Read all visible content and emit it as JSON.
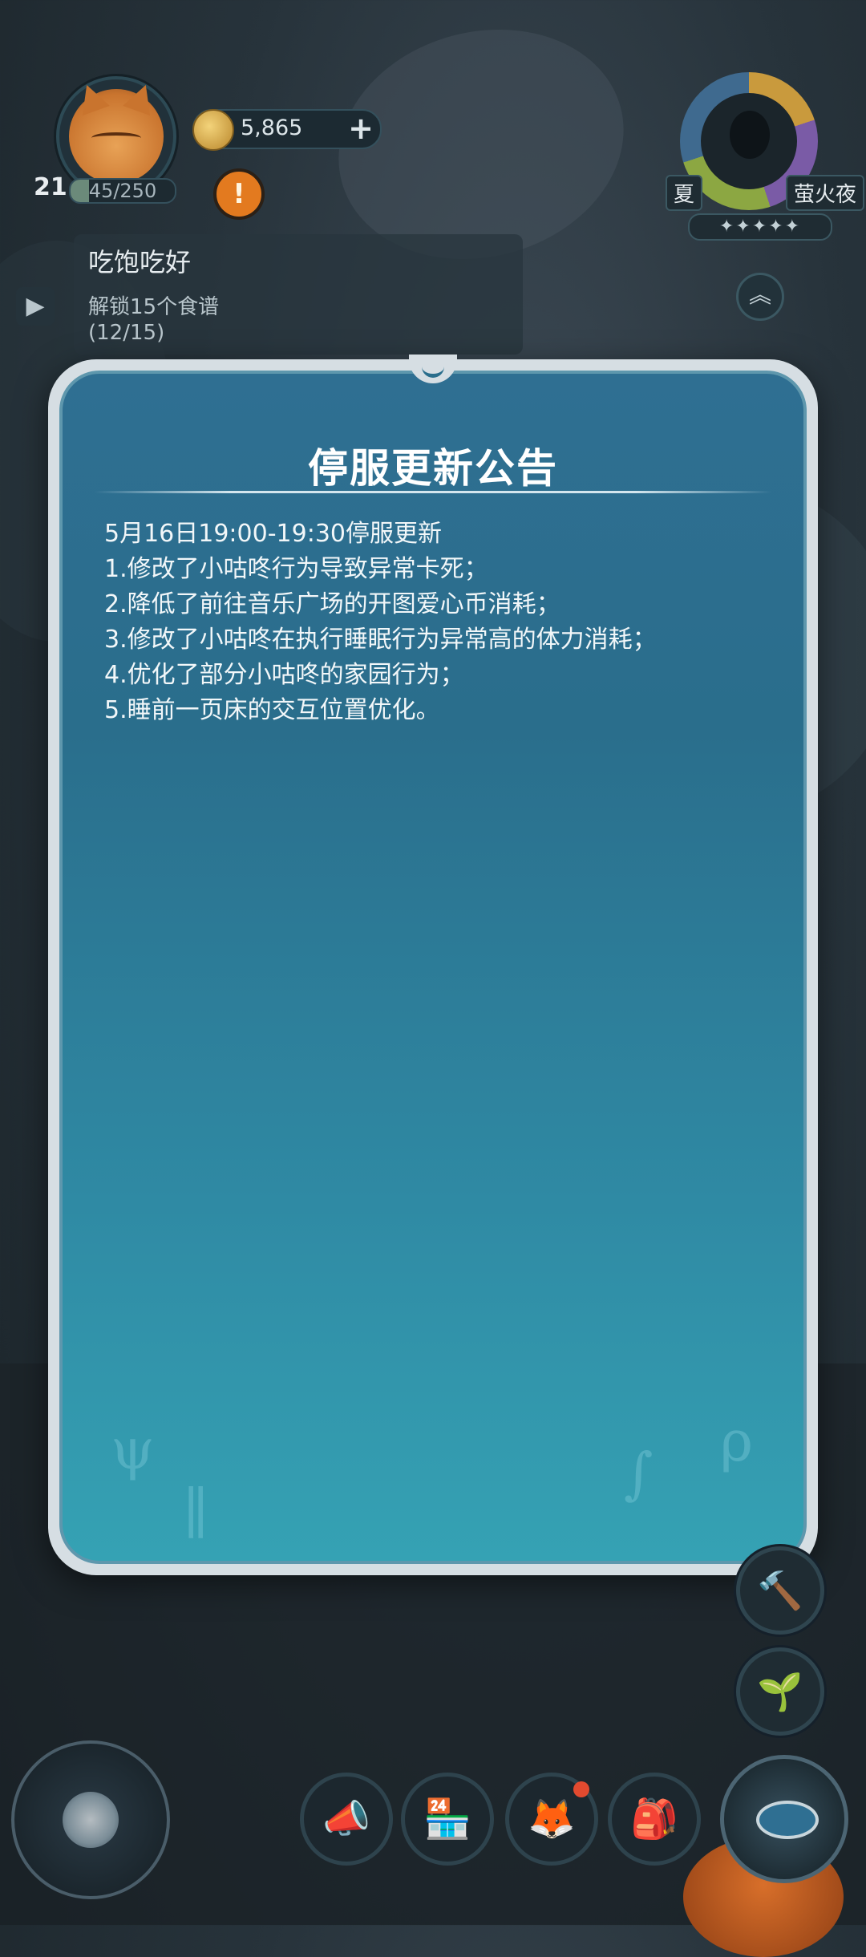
{
  "player": {
    "level": "21",
    "exp_text": "45/250",
    "exp_fraction": 0.18
  },
  "currency": {
    "coins": "5,865",
    "add_label": "+"
  },
  "alert": {
    "label": "!"
  },
  "quest": {
    "title": "吃饱吃好",
    "description": "解锁15个食谱",
    "progress": "(12/15)"
  },
  "season": {
    "season_label": "夏",
    "time_label": "萤火夜",
    "stars": "✦✦✦✦✦"
  },
  "notice": {
    "title": "停服更新公告",
    "lines": [
      "5月16日19:00-19:30停服更新",
      "1.修改了小咕咚行为导致异常卡死；",
      "2.降低了前往音乐广场的开图爱心币消耗；",
      "3.修改了小咕咚在执行睡眠行为异常高的体力消耗；",
      "4.优化了部分小咕咚的家园行为；",
      "5.睡前一页床的交互位置优化。"
    ]
  },
  "icons": {
    "quest_toggle": "▶",
    "up_arrows": "︽",
    "hammer": "🔨",
    "sprout": "🌱",
    "megaphone": "📣",
    "shop": "🏪",
    "pet": "🦊",
    "backpack": "🎒"
  }
}
